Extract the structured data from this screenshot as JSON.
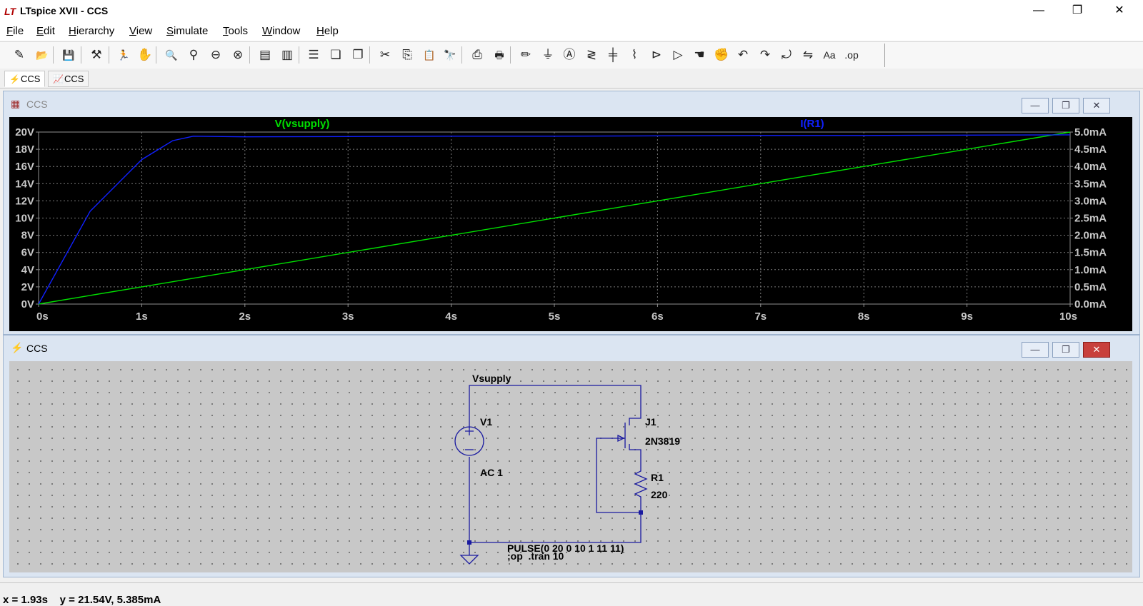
{
  "window": {
    "app_icon": "LT",
    "title": "LTspice XVII - CCS",
    "controls": {
      "minimize": "—",
      "maximize": "❐",
      "close": "✕"
    }
  },
  "menu": [
    "File",
    "Edit",
    "Hierarchy",
    "View",
    "Simulate",
    "Tools",
    "Window",
    "Help"
  ],
  "toolbar": {
    "icons": [
      {
        "name": "new-schematic-icon",
        "glyph": "✎"
      },
      {
        "name": "open-icon",
        "glyph": "📂"
      },
      {
        "name": "save-icon",
        "glyph": "💾"
      },
      {
        "name": "control-panel-icon",
        "glyph": "⚒"
      },
      {
        "name": "run-icon",
        "glyph": "🏃"
      },
      {
        "name": "halt-icon",
        "glyph": "✋"
      },
      {
        "name": "zoom-in-icon",
        "glyph": "🔍"
      },
      {
        "name": "zoom-pan-icon",
        "glyph": "⚲"
      },
      {
        "name": "zoom-out-icon",
        "glyph": "⊖"
      },
      {
        "name": "zoom-fit-icon",
        "glyph": "⊗"
      },
      {
        "name": "autorange-icon",
        "glyph": "▤"
      },
      {
        "name": "waveform-icon",
        "glyph": "▥"
      },
      {
        "name": "tile-horizontal-icon",
        "glyph": "☰"
      },
      {
        "name": "cascade-icon",
        "glyph": "❏"
      },
      {
        "name": "tile-vertical-icon",
        "glyph": "❐"
      },
      {
        "name": "cut-icon",
        "glyph": "✂"
      },
      {
        "name": "copy-icon",
        "glyph": "⎘"
      },
      {
        "name": "paste-icon",
        "glyph": "📋"
      },
      {
        "name": "find-icon",
        "glyph": "🔭"
      },
      {
        "name": "print-icon",
        "glyph": "⎙"
      },
      {
        "name": "print-preview-icon",
        "glyph": "🖶"
      },
      {
        "name": "draw-wire-icon",
        "glyph": "✏"
      },
      {
        "name": "ground-icon",
        "glyph": "⏚"
      },
      {
        "name": "label-net-icon",
        "glyph": "Ⓐ"
      },
      {
        "name": "resistor-icon",
        "glyph": "≷"
      },
      {
        "name": "capacitor-icon",
        "glyph": "╪"
      },
      {
        "name": "inductor-icon",
        "glyph": "⌇"
      },
      {
        "name": "diode-icon",
        "glyph": "⊳"
      },
      {
        "name": "component-icon",
        "glyph": "▷"
      },
      {
        "name": "move-icon",
        "glyph": "☚"
      },
      {
        "name": "drag-icon",
        "glyph": "✊"
      },
      {
        "name": "undo-icon",
        "glyph": "↶"
      },
      {
        "name": "redo-icon",
        "glyph": "↷"
      },
      {
        "name": "rotate-icon",
        "glyph": "⤾"
      },
      {
        "name": "mirror-icon",
        "glyph": "⇋"
      },
      {
        "name": "text-icon",
        "glyph": "Aa"
      },
      {
        "name": "spice-directive-icon",
        "glyph": ".op"
      }
    ]
  },
  "tabs": [
    {
      "label": "CCS",
      "icon": "schematic-tab-icon",
      "glyph": "⚡"
    },
    {
      "label": "CCS",
      "icon": "waveform-tab-icon",
      "glyph": "📈"
    }
  ],
  "plot_window": {
    "title": "CCS",
    "controls": {
      "minimize": "—",
      "maximize": "❐",
      "close": "✕"
    }
  },
  "schematic_window": {
    "title": "CCS",
    "controls": {
      "minimize": "—",
      "maximize": "❐",
      "close": "✕"
    },
    "labels": {
      "net_vsupply": "Vsupply",
      "v1_name": "V1",
      "v1_value": "AC 1",
      "j1_name": "J1",
      "j1_model": "2N3819",
      "r1_name": "R1",
      "r1_value": "220",
      "pulse": "PULSE(0 20 0 10 1 11 11)",
      "directives": ";op  .tran 10"
    }
  },
  "chart_data": {
    "type": "line",
    "title": "",
    "background": "#000000",
    "grid": true,
    "x": [
      0,
      0.5,
      1,
      1.3,
      1.5,
      2,
      3,
      4,
      5,
      6,
      7,
      8,
      9,
      10
    ],
    "xlim": [
      0,
      10
    ],
    "x_ticks": [
      "0s",
      "1s",
      "2s",
      "3s",
      "4s",
      "5s",
      "6s",
      "7s",
      "8s",
      "9s",
      "10s"
    ],
    "y_left_lim": [
      0,
      20
    ],
    "y_left_ticks": [
      "0V",
      "2V",
      "4V",
      "6V",
      "8V",
      "10V",
      "12V",
      "14V",
      "16V",
      "18V",
      "20V"
    ],
    "y_right_lim": [
      0,
      5.0
    ],
    "y_right_ticks": [
      "0.0mA",
      "0.5mA",
      "1.0mA",
      "1.5mA",
      "2.0mA",
      "2.5mA",
      "3.0mA",
      "3.5mA",
      "4.0mA",
      "4.5mA",
      "5.0mA"
    ],
    "series": [
      {
        "name": "V(vsupply)",
        "axis": "left",
        "color": "#00e000",
        "values": [
          0,
          1,
          2,
          2.6,
          3,
          4,
          6,
          8,
          10,
          12,
          14,
          16,
          18,
          20
        ]
      },
      {
        "name": "I(R1)",
        "axis": "right",
        "color": "#1020ff",
        "values": [
          0,
          2.7,
          4.2,
          4.75,
          4.88,
          4.86,
          4.87,
          4.88,
          4.88,
          4.89,
          4.9,
          4.9,
          4.91,
          4.92
        ]
      }
    ]
  },
  "status": {
    "cursor": "x = 1.93s    y = 21.54V, 5.385mA"
  }
}
